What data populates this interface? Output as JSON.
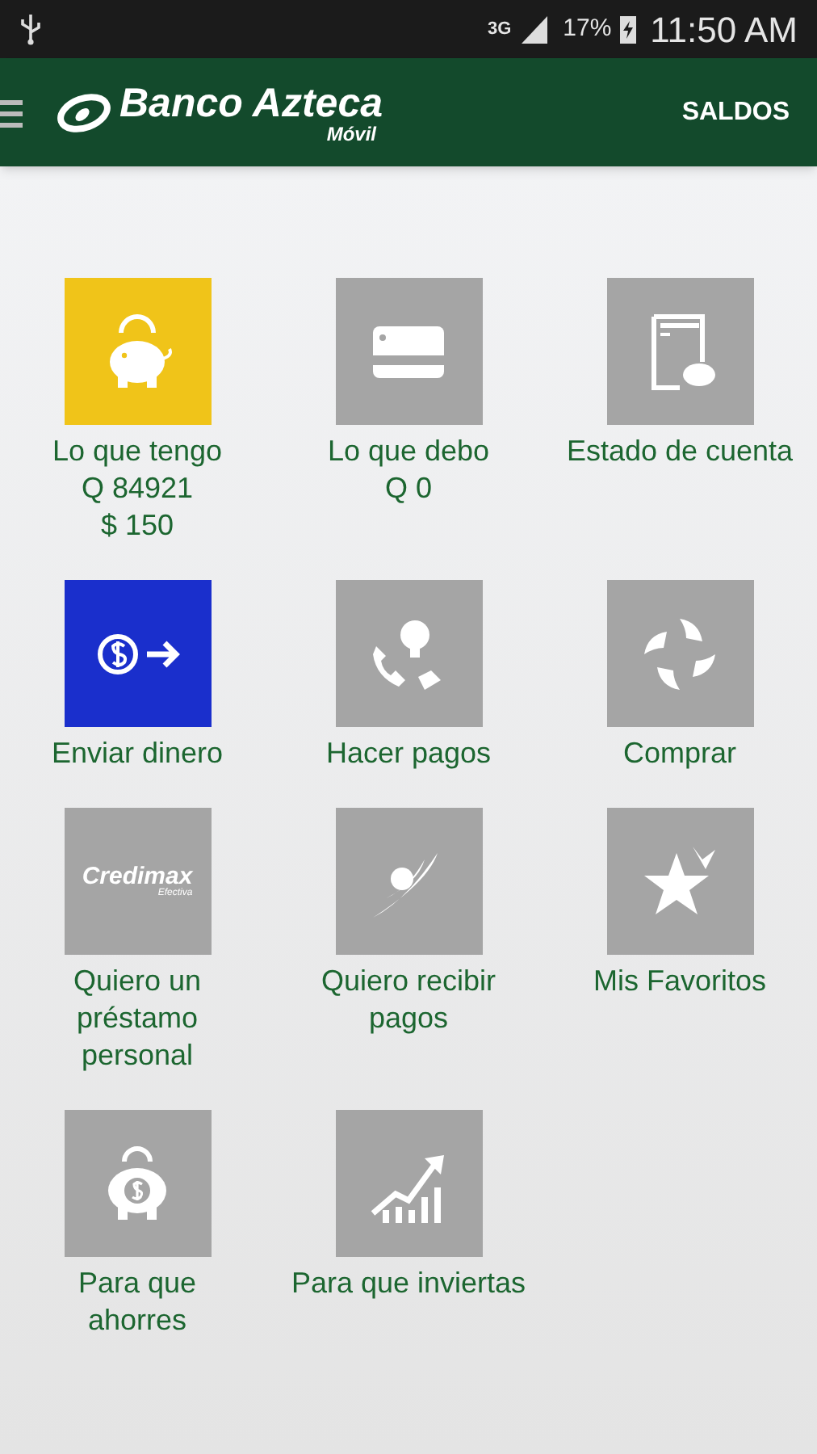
{
  "status_bar": {
    "network": "3G",
    "battery": "17%",
    "time": "11:50 AM"
  },
  "header": {
    "brand": "Banco Azteca",
    "subtitle": "Móvil",
    "action": "SALDOS"
  },
  "tiles": [
    {
      "kind": "piggy",
      "color": "#f0c419",
      "lines": [
        "Lo que tengo",
        "Q 84921",
        "$ 150"
      ]
    },
    {
      "kind": "card",
      "color": "#a5a5a5",
      "lines": [
        "Lo que debo",
        "Q 0"
      ]
    },
    {
      "kind": "statement",
      "color": "#a5a5a5",
      "lines": [
        "Estado de cuenta"
      ]
    },
    {
      "kind": "send",
      "color": "#1a2fcc",
      "lines": [
        "Enviar dinero"
      ]
    },
    {
      "kind": "payments",
      "color": "#a5a5a5",
      "lines": [
        "Hacer pagos"
      ]
    },
    {
      "kind": "shop",
      "color": "#a5a5a5",
      "lines": [
        "Comprar"
      ]
    },
    {
      "kind": "credimax",
      "color": "#a5a5a5",
      "logo": "Credimax",
      "logo_sub": "Efectiva",
      "lines": [
        "Quiero un",
        "préstamo",
        "personal"
      ]
    },
    {
      "kind": "receive",
      "color": "#a5a5a5",
      "lines": [
        "Quiero recibir",
        "pagos"
      ]
    },
    {
      "kind": "star",
      "color": "#a5a5a5",
      "lines": [
        "Mis Favoritos"
      ]
    },
    {
      "kind": "save",
      "color": "#a5a5a5",
      "lines": [
        "Para que",
        "ahorres"
      ]
    },
    {
      "kind": "invest",
      "color": "#a5a5a5",
      "lines": [
        "Para que inviertas"
      ]
    }
  ]
}
